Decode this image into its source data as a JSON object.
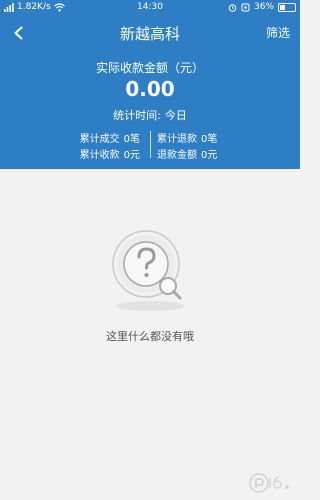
{
  "status_bar": {
    "network_speed": "1.82K/s",
    "time": "14:30",
    "battery_percent": "36%",
    "battery_level": 0.36
  },
  "nav": {
    "back_icon": "chevron-left-icon",
    "title": "新越高科",
    "filter_label": "筛选"
  },
  "summary": {
    "amount_label": "实际收款金额（元）",
    "amount_value": "0.00",
    "stat_time_label": "统计时间:",
    "stat_time_value": "今日"
  },
  "stats": {
    "total_deals_label": "累计成交",
    "total_deals_value": "0笔",
    "total_refunds_label": "累计退款",
    "total_refunds_value": "0笔",
    "total_received_label": "累计收款",
    "total_received_value": "0元",
    "refund_amount_label": "退款金额",
    "refund_amount_value": "0元"
  },
  "empty_state": {
    "icon": "question-search-icon",
    "message": "这里什么都没有哦"
  },
  "colors": {
    "header_bg": "#2d7ec4",
    "page_bg": "#f2f2f2"
  }
}
